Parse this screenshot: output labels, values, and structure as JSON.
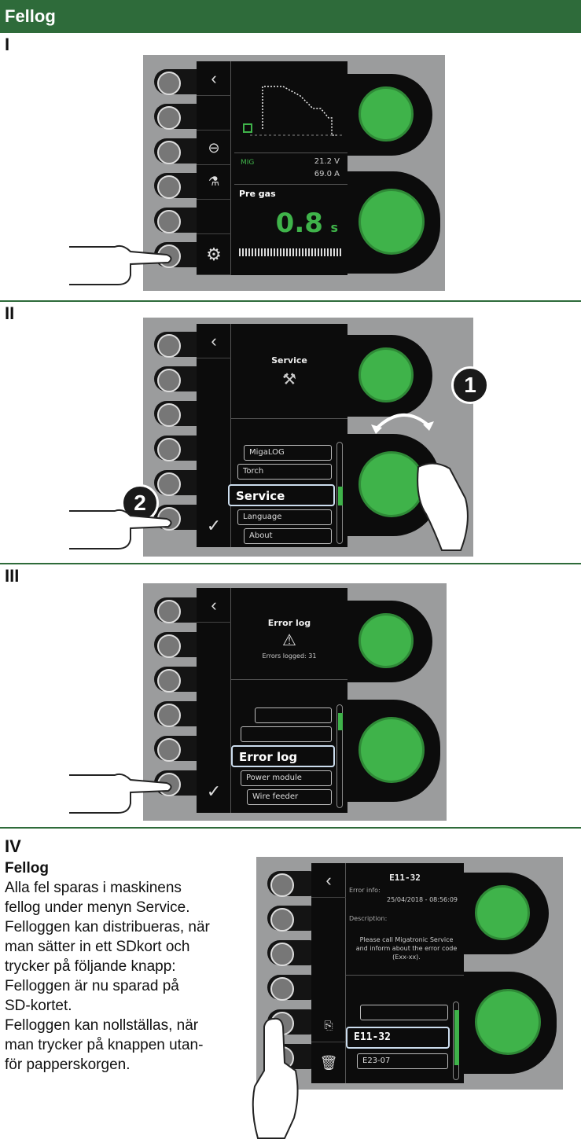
{
  "header": {
    "title": "Fellog"
  },
  "panels": [
    {
      "step": "I"
    },
    {
      "step": "II"
    },
    {
      "step": "III"
    },
    {
      "step": "IV"
    }
  ],
  "screen1": {
    "voltage": "21.2 V",
    "current": "69.0 A",
    "param_label": "Pre gas",
    "param_value": "0.8",
    "param_unit": "s"
  },
  "screen2": {
    "title": "Service",
    "menu_items": [
      "MigaLOG",
      "Torch",
      "Service",
      "Language",
      "About"
    ],
    "badge_1": "1",
    "badge_2": "2"
  },
  "screen3": {
    "title": "Error log",
    "subtitle": "Errors logged: 31",
    "menu_items": [
      "",
      "",
      "Error log",
      "Power module",
      "Wire feeder"
    ]
  },
  "screen4": {
    "code": "E11-32",
    "info_label": "Error info:",
    "info_value": "25/04/2018 - 08:56:09",
    "desc_label": "Description:",
    "desc_text": "Please call Migatronic Service and inform about the error code (Exx-xx).",
    "list_items": [
      "",
      "E11-32",
      "E23-07"
    ]
  },
  "text": {
    "title": "Fellog",
    "lines": [
      "Alla fel sparas i maskinens",
      "fellog under menyn Service.",
      "Felloggen kan distribueras, när",
      "man sätter in ett SDkort och",
      "trycker på följande knapp:",
      "Felloggen är nu sparad på",
      "SD-kortet.",
      "Felloggen kan nollställas, när",
      "man trycker på knappen utan-",
      "för papperskorgen."
    ]
  },
  "colors": {
    "brand_green": "#2e6b3a",
    "knob_green": "#3fb34a"
  }
}
